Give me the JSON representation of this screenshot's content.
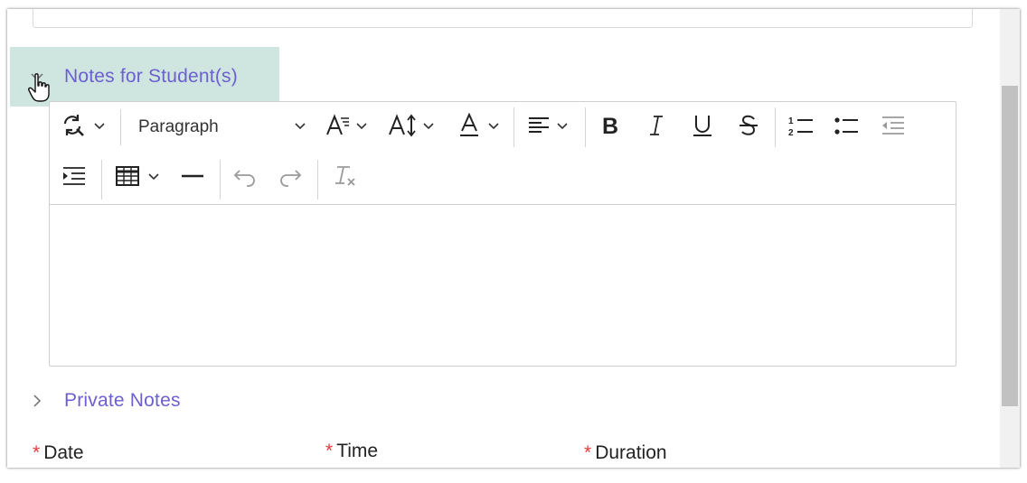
{
  "sections": {
    "notes_for_students": "Notes for Student(s)",
    "private_notes": "Private Notes"
  },
  "editor": {
    "paragraph_format": "Paragraph",
    "icons": [
      "accessibility-check-icon",
      "text-size-icon",
      "line-height-icon",
      "font-color-icon",
      "align-icon",
      "bold-icon",
      "italic-icon",
      "underline-icon",
      "strikethrough-icon",
      "numbered-list-icon",
      "bullet-list-icon",
      "outdent-icon",
      "indent-icon",
      "table-icon",
      "horizontal-line-icon",
      "undo-icon",
      "redo-icon",
      "clear-formatting-icon"
    ],
    "content": ""
  },
  "fields": {
    "date_label": "Date",
    "time_label": "Time",
    "duration_label": "Duration",
    "required_marker": "*"
  },
  "colors": {
    "section_link": "#6b5fd1",
    "highlight": "#cfe5df",
    "required": "#e23b3b"
  }
}
